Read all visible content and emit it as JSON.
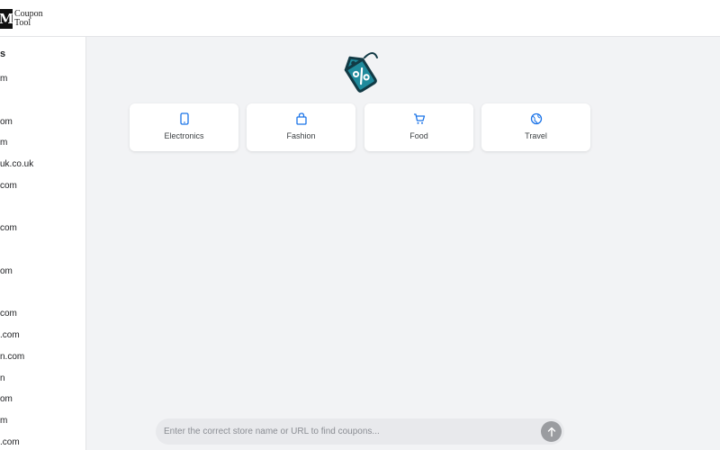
{
  "app": {
    "logo_mark": "M",
    "logo_line1": "Coupon",
    "logo_line2": "Tool"
  },
  "sidebar": {
    "heading": "s",
    "items": [
      {
        "label": "m"
      },
      {
        "label": "om"
      },
      {
        "label": "m"
      },
      {
        "label": "uk.co.uk"
      },
      {
        "label": "com"
      },
      {
        "label": "com"
      },
      {
        "label": "om"
      },
      {
        "label": "com"
      },
      {
        "label": ".com"
      },
      {
        "label": "n.com"
      },
      {
        "label": "n"
      },
      {
        "label": "om"
      },
      {
        "label": "m"
      },
      {
        "label": ".com"
      }
    ]
  },
  "hero": {
    "icon": "coupon-tag-icon",
    "icon_color": "#1f8a9c"
  },
  "categories": [
    {
      "label": "Electronics",
      "icon": "tablet-icon"
    },
    {
      "label": "Fashion",
      "icon": "bag-icon"
    },
    {
      "label": "Food",
      "icon": "cart-icon"
    },
    {
      "label": "Travel",
      "icon": "globe-icon"
    }
  ],
  "search": {
    "value": "",
    "placeholder": "Enter the correct store name or URL to find coupons...",
    "submit_icon": "arrow-up-icon"
  },
  "colors": {
    "accent": "#1a73e8",
    "background": "#f2f3f5",
    "submit_button": "#9a9ca0"
  }
}
